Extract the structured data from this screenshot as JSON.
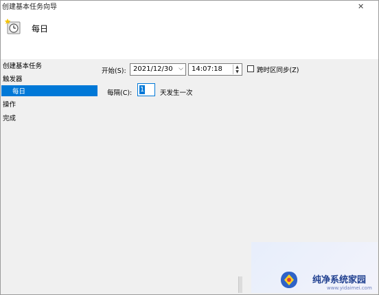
{
  "window": {
    "title": "创建基本任务向导",
    "close_glyph": "✕"
  },
  "header": {
    "title": "每日",
    "icon": "scheduled-task-clock-icon"
  },
  "nav": {
    "items": [
      {
        "label": "创建基本任务"
      },
      {
        "label": "触发器"
      },
      {
        "label": "每日",
        "selected": true
      },
      {
        "label": "操作"
      },
      {
        "label": "完成"
      }
    ]
  },
  "form": {
    "start_label": "开始(S):",
    "start_date": "2021/12/30",
    "start_time": "14:07:18",
    "sync_timezone_label": "跨时区同步(Z)",
    "sync_timezone_checked": false,
    "recur_label": "每隔(C):",
    "recur_value": "1",
    "recur_suffix": "天发生一次"
  },
  "watermark": {
    "text": "纯净系统家园",
    "url": "www.yidaimei.com"
  },
  "colors": {
    "accent": "#0078d7",
    "content_bg": "#f0f0f0"
  }
}
